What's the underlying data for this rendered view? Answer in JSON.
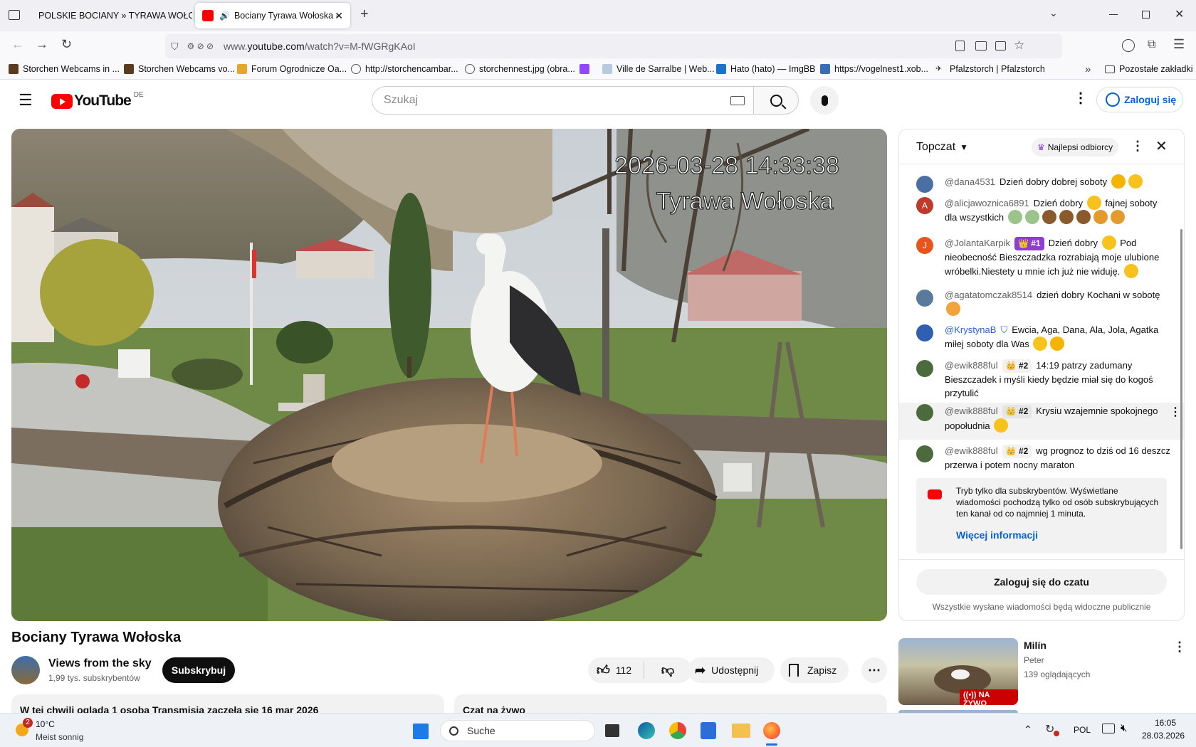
{
  "browser": {
    "tabs": [
      {
        "title": "POLSKIE BOCIANY » TYRAWA WOŁOSKA",
        "active": false
      },
      {
        "title": "Bociany Tyrawa Wołoska - YouTube",
        "active": true
      }
    ],
    "url_prefix": "www.",
    "url_domain": "youtube.com",
    "url_path": "/watch?v=M-fWGRgKAoI",
    "bookmarks": [
      "Storchen Webcams in ...",
      "Storchen Webcams vo...",
      "Forum Ogrodnicze Oa...",
      "http://storchencambar...",
      "storchennest.jpg (obra...",
      "Ville de Sarralbe | Web...",
      "Hato (hato) — ImgBB",
      "https://vogelnest1.xob...",
      "Pfalzstorch | Pfalzstorch"
    ],
    "other_bookmarks": "Pozostałe zakładki"
  },
  "youtube": {
    "logo_text": "YouTube",
    "region": "DE",
    "search_placeholder": "Szukaj",
    "sign_in": "Zaloguj się"
  },
  "video": {
    "overlay_datetime": "2026-03-28 14:33:38",
    "overlay_location": "Tyrawa Wołoska",
    "title": "Bociany Tyrawa Wołoska",
    "channel_name": "Views from the sky",
    "subscribers": "1,99 tys. subskrybentów",
    "subscribe_label": "Subskrybuj",
    "likes": "112",
    "share_label": "Udostępnij",
    "save_label": "Zapisz",
    "description_preview": "W tej chwili ogląda 1 osoba  Transmisja zaczęła się 16 mar 2026",
    "live_chat_label": "Czat na żywo"
  },
  "chat": {
    "mode": "Topczat",
    "top_viewers": "Najlepsi odbiorcy",
    "messages": [
      {
        "author": "@dana4531",
        "badge": "",
        "text": "Dzień dobry dobrej soboty",
        "avatar_color": "#4a6fa5",
        "avatar_letter": "",
        "emoji_colors": [
          "#f5b400",
          "#f7c21b"
        ]
      },
      {
        "author": "@alicjawoznica6891",
        "badge": "",
        "text": "Dzień dobry",
        "text2": "fajnej soboty dla wszystkich",
        "avatar_color": "#c0392b",
        "avatar_letter": "A",
        "emoji_colors": [
          "#7fb069",
          "#7fb069",
          "#8b5a2b",
          "#8b5a2b",
          "#8b5a2b",
          "#e39b2d",
          "#e39b2d"
        ]
      },
      {
        "author": "@JolantaKarpik",
        "badge": "👑 #1",
        "text": "Dzień dobry",
        "text2": "Pod nieobecność Bieszczadzka rozrabiają moje ulubione wróbelki.Niestety u mnie ich już nie widuję.",
        "avatar_color": "#e8541a",
        "avatar_letter": "J"
      },
      {
        "author": "@agatatomczak8514",
        "badge": "",
        "text": "dzień dobry Kochani w sobotę",
        "avatar_color": "#5a7a9c",
        "avatar_letter": ""
      },
      {
        "author": "@KrystynaB",
        "badge": "",
        "text": "Ewcia, Aga, Dana, Ala, Jola, Agatka miłej soboty dla Was",
        "avatar_color": "#2e5fb0",
        "avatar_letter": ""
      },
      {
        "author": "@ewik888ful",
        "badge": "👑 #2",
        "text": "14:19 patrzy zadumany Bieszczadek i myśli kiedy będzie miał się do kogoś przytulić",
        "avatar_color": "#4c6b3c",
        "avatar_letter": ""
      },
      {
        "author": "@ewik888ful",
        "badge": "👑 #2",
        "text": "Krysiu wzajemnie spokojnego popołudnia",
        "avatar_color": "#4c6b3c",
        "avatar_letter": ""
      },
      {
        "author": "@ewik888ful",
        "badge": "👑 #2",
        "text": "wg prognoz to dziś od 16 deszcz przerwa i potem nocny maraton",
        "avatar_color": "#4c6b3c",
        "avatar_letter": ""
      }
    ],
    "notice_text": "Tryb tylko dla subskrybentów. Wyświetlane wiadomości pochodzą tylko od osób subskrybujących ten kanał od co najmniej 1 minuta.",
    "notice_link": "Więcej informacji",
    "login_button": "Zaloguj się do czatu",
    "public_note": "Wszystkie wysłane wiadomości będą widoczne publicznie"
  },
  "recommended": {
    "title": "Milín",
    "channel": "Peter",
    "viewers": "139 oglądających",
    "live_badge": "NA ŻYWO"
  },
  "taskbar": {
    "weather_temp": "10°C",
    "weather_desc": "Meist sonnig",
    "weather_badge": "2",
    "search_placeholder": "Suche",
    "language": "POL",
    "time": "16:05",
    "date": "28.03.2026"
  }
}
